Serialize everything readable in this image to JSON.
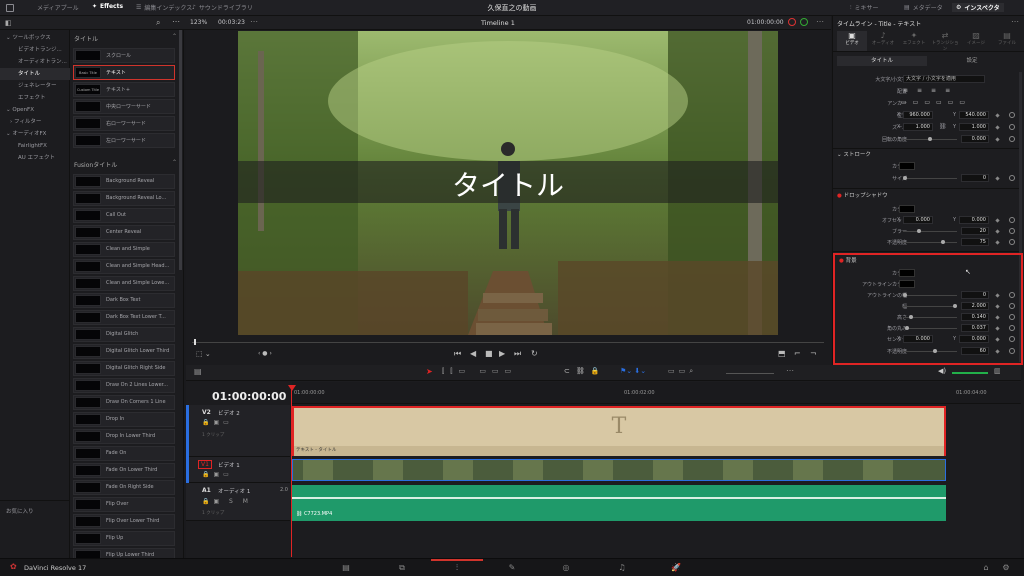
{
  "topbar": {
    "media_pool": "メディアプール",
    "effects": "Effects",
    "edit_index": "編集インデックス",
    "sound_library": "サウンドライブラリ",
    "project_title": "久保直之の動画",
    "mixer": "ミキサー",
    "metadata": "メタデータ",
    "inspector": "インスペクタ"
  },
  "viewer_bar": {
    "zoom": "123%",
    "timecode_left": "00:03:23",
    "timeline_name": "Timeline 1",
    "timecode_right": "01:00:00:00"
  },
  "left_nav": {
    "toolbox": "ツールボックス",
    "video_transitions": "ビデオトランジ...",
    "audio_transitions": "オーディオトラン...",
    "titles": "タイトル",
    "generators": "ジェネレーター",
    "effects": "エフェクト",
    "openfx": "OpenFX",
    "filters": "フィルター",
    "audiofx": "オーディオFX",
    "fairlight": "FairlightFX",
    "au": "AU エフェクト",
    "favorites": "お気に入り"
  },
  "effects_panel": {
    "section_titles": "タイトル",
    "titles": [
      {
        "thumb": "",
        "label": "スクロール"
      },
      {
        "thumb": "Basic Title",
        "label": "テキスト"
      },
      {
        "thumb": "Custom Title",
        "label": "テキスト+"
      },
      {
        "thumb": "",
        "label": "中央ローワーサード"
      },
      {
        "thumb": "",
        "label": "右ローワーサード"
      },
      {
        "thumb": "",
        "label": "左ローワーサード"
      }
    ],
    "section_fusion": "Fusionタイトル",
    "fusion": [
      "Background Reveal",
      "Background Reveal Lo...",
      "Call Out",
      "Center Reveal",
      "Clean and Simple",
      "Clean and Simple Head...",
      "Clean and Simple Lowe...",
      "Dark Box Text",
      "Dark Box Text Lower T...",
      "Digital Glitch",
      "Digital Glitch Lower Third",
      "Digital Glitch Right Side",
      "Draw On 2 Lines Lower...",
      "Draw On Corners 1 Line",
      "Drop In",
      "Drop In Lower Third",
      "Fade On",
      "Fade On Lower Third",
      "Fade On Right Side",
      "Flip Over",
      "Flip Over Lower Third",
      "Flip Up",
      "Flip Up Lower Third"
    ]
  },
  "preview": {
    "title_text": "タイトル"
  },
  "timeline": {
    "timecode": "01:00:00:00",
    "ruler": [
      "01:00:00:00",
      "01:00:02:00",
      "01:00:04:00"
    ],
    "tracks": [
      {
        "id": "V2",
        "name": "ビデオ 2",
        "sub": "1 クリップ"
      },
      {
        "id": "V1",
        "name": "ビデオ 1",
        "sub": ""
      },
      {
        "id": "A1",
        "name": "オーディオ 1",
        "sub": "1 クリップ",
        "level": "2.0"
      }
    ],
    "title_clip": "テキスト - タイトル",
    "title_glyph": "T",
    "audio_clip": "C7723.MP4"
  },
  "inspector": {
    "header": "タイムライン - Title - テキスト",
    "tabs": [
      "ビデオ",
      "オーディオ",
      "エフェクト",
      "トランジション",
      "イメージ",
      "ファイル"
    ],
    "sub_tabs": [
      "タイトル",
      "設定"
    ],
    "case_label": "大文字/小文字",
    "case_value": "大文字 / 小文字を適用",
    "align_label": "配置",
    "anchor_label": "アンカー",
    "position_label": "位置",
    "pos_x": "960.000",
    "pos_y": "540.000",
    "zoom_label": "ズーム",
    "zoom_x": "1.000",
    "zoom_y": "1.000",
    "rotation_label": "回転の角度",
    "rotation": "0.000",
    "stroke": {
      "title": "ストローク",
      "color": "カラー",
      "size": "サイズ",
      "size_val": "0"
    },
    "shadow": {
      "title": "ドロップシャドウ",
      "color": "カラー",
      "offset": "オフセット",
      "ox": "0.000",
      "oy": "0.000",
      "blur": "ブラー",
      "blur_val": "20",
      "opacity": "不透明度",
      "opacity_val": "75"
    },
    "bg": {
      "title": "背景",
      "color": "カラー",
      "outline_color": "アウトラインカラー",
      "outline_width": "アウトラインの幅",
      "ow_val": "0",
      "width": "幅",
      "width_val": "2.000",
      "height": "高さ",
      "height_val": "0.140",
      "corner": "角の丸み",
      "corner_val": "0.037",
      "center": "センター",
      "cx": "0.000",
      "cy": "0.000",
      "opacity": "不透明度",
      "opacity_val": "60"
    },
    "x": "X",
    "y": "Y"
  },
  "footer": {
    "app": "DaVinci Resolve 17"
  },
  "colors": {
    "accent_red": "#e02424",
    "title_clip": "#d8c8a4",
    "audio_clip": "#1f9a6a",
    "video_clip": "#3a4a3c"
  }
}
